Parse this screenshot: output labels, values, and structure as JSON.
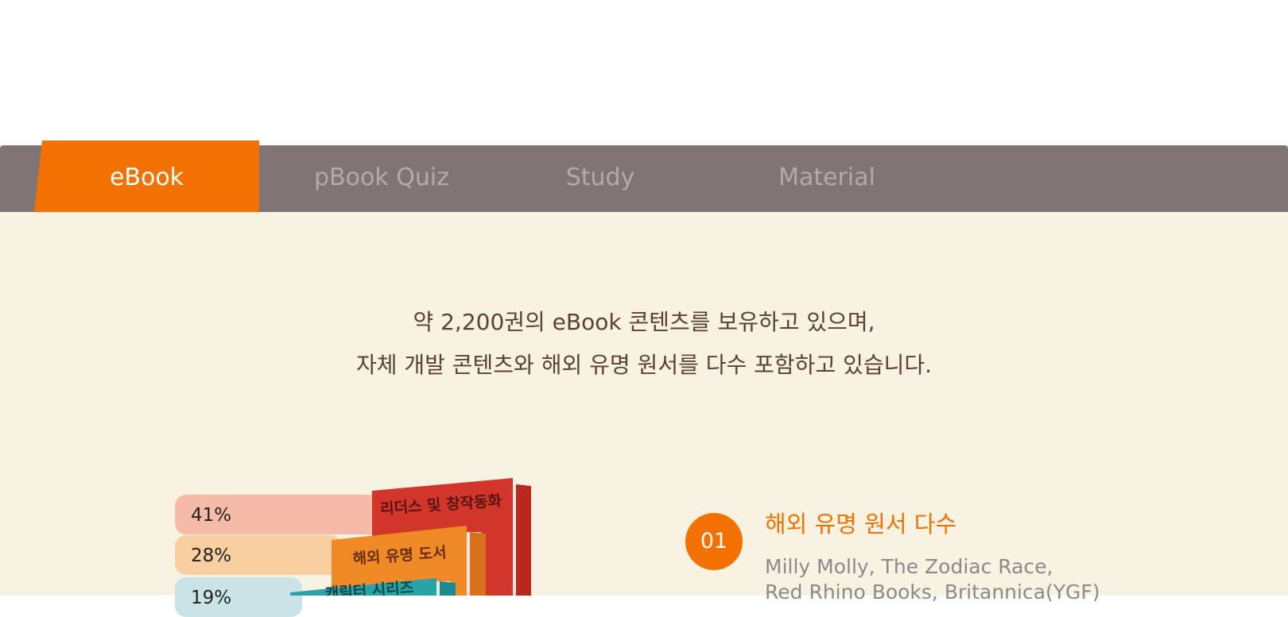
{
  "tabs": [
    {
      "label": "eBook",
      "active": true
    },
    {
      "label": "pBook Quiz",
      "active": false
    },
    {
      "label": "Study",
      "active": false
    },
    {
      "label": "Material",
      "active": false
    }
  ],
  "intro": {
    "line1": "약 2,200권의 eBook 콘텐츠를 보유하고 있으며,",
    "line2": "자체 개발 콘텐츠와 해외 유명 원서를 다수 포함하고 있습니다."
  },
  "distribution": [
    {
      "percent": "41%",
      "value": 41,
      "book_label": "리더스 및 창작동화",
      "color": "#f5baa8"
    },
    {
      "percent": "28%",
      "value": 28,
      "book_label": "해외 유명 도서",
      "color": "#f8cfa0"
    },
    {
      "percent": "19%",
      "value": 19,
      "book_label": "캐릭터 시리즈",
      "color": "#c9e3e6"
    }
  ],
  "feature": {
    "number": "01",
    "title": "해외 유명 원서 다수",
    "description_line1": "Milly Molly, The Zodiac Race,",
    "description_line2": "Red Rhino Books, Britannica(YGF)"
  },
  "colors": {
    "accent": "#f27100",
    "tabbar": "#807474",
    "content_bg": "#f8f2e2",
    "intro_text": "#5c4030"
  }
}
